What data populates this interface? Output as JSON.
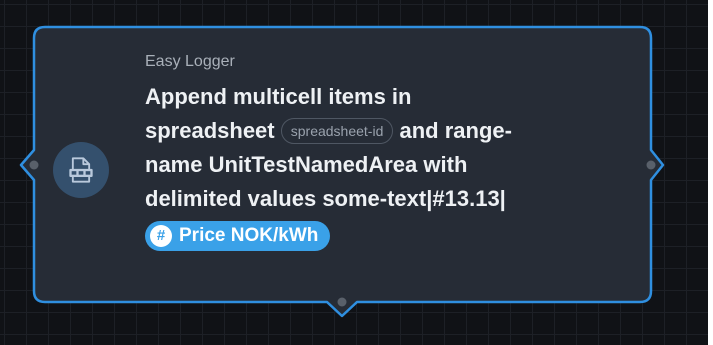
{
  "node": {
    "category": "Easy Logger",
    "line1": "Append multicell items in",
    "spreadsheet_word": "spreadsheet",
    "spreadsheet_token": "spreadsheet-id",
    "and_range": "and range-",
    "name_word": "name",
    "range_name": "UnitTestNamedArea",
    "with_word": "with",
    "delimited_text": "delimited values",
    "delimited_value": "some-text|#13.13|",
    "variable_label": "Price NOK/kWh",
    "variable_icon": "hash-icon",
    "node_icon": "spreadsheet-icon"
  },
  "colors": {
    "background": "#101216",
    "node_fill": "#262c36",
    "node_border": "#2f8fe0",
    "icon_circle": "#34506d",
    "chip": "#3aa1e8"
  }
}
